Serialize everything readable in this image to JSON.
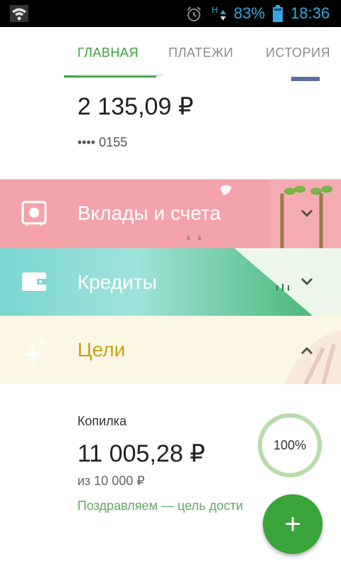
{
  "status_bar": {
    "battery_percent": "83%",
    "time": "18:36",
    "network_label": "H"
  },
  "tabs": [
    {
      "label": "ГЛАВНАЯ",
      "active": true
    },
    {
      "label": "ПЛАТЕЖИ",
      "active": false
    },
    {
      "label": "ИСТОРИЯ",
      "active": false
    }
  ],
  "card": {
    "balance": "2 135,09 ₽",
    "number_masked": "•••• 0155"
  },
  "sections": {
    "deposits": {
      "title": "Вклады и счета",
      "icon": "safe-icon",
      "expanded": false
    },
    "credits": {
      "title": "Кредиты",
      "icon": "wallet-icon",
      "expanded": false
    },
    "goals": {
      "title": "Цели",
      "icon": "sparkle-icon",
      "expanded": true
    }
  },
  "goal": {
    "name": "Копилка",
    "amount": "11 005,28 ₽",
    "target": "из 10 000 ₽",
    "status": "Поздравляем — цель дости",
    "progress_label": "100%",
    "progress_fraction": 1.0
  },
  "fab": {
    "label": "+"
  },
  "colors": {
    "accent": "#3aa33a",
    "deposits_band": "#f4a3ab",
    "credits_band": "#7ad6d0",
    "goals_band": "#fbf7e4",
    "goals_title": "#c9a21a",
    "status_blue": "#35a7e0"
  }
}
